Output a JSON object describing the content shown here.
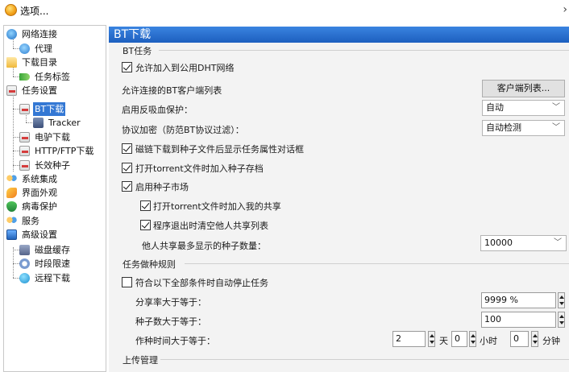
{
  "window": {
    "title": "选项...",
    "chevron": "›"
  },
  "tree": {
    "items": [
      {
        "label": "网络连接",
        "icon": "network-icon"
      },
      {
        "label": "代理",
        "icon": "proxy-icon"
      },
      {
        "label": "下载目录",
        "icon": "folder-icon"
      },
      {
        "label": "任务标签",
        "icon": "tag-icon"
      },
      {
        "label": "任务设置",
        "icon": "task-settings-icon"
      },
      {
        "label": "BT下载",
        "icon": "bt-icon"
      },
      {
        "label": "Tracker",
        "icon": "tracker-icon"
      },
      {
        "label": "电驴下载",
        "icon": "emule-icon"
      },
      {
        "label": "HTTP/FTP下载",
        "icon": "http-ftp-icon"
      },
      {
        "label": "长效种子",
        "icon": "seed-icon"
      },
      {
        "label": "系统集成",
        "icon": "system-integration-icon"
      },
      {
        "label": "界面外观",
        "icon": "appearance-icon"
      },
      {
        "label": "病毒保护",
        "icon": "virus-shield-icon"
      },
      {
        "label": "服务",
        "icon": "service-icon"
      },
      {
        "label": "高级设置",
        "icon": "advanced-icon"
      },
      {
        "label": "磁盘缓存",
        "icon": "disk-cache-icon"
      },
      {
        "label": "时段限速",
        "icon": "time-limit-icon"
      },
      {
        "label": "远程下载",
        "icon": "remote-download-icon"
      }
    ]
  },
  "panel": {
    "header": "BT下载",
    "group_bt_tasks": "BT任务",
    "allow_dht": "允许加入到公用DHT网络",
    "allowed_clients": "允许连接的BT客户端列表",
    "client_list_button": "客户端列表...",
    "anti_leech_label": "启用反吸血保护：",
    "anti_leech_value": "自动",
    "encryption_label": "协议加密（防范BT协议过滤）：",
    "encryption_value": "自动检测",
    "magnet_show_props": "磁链下载到种子文件后显示任务属性对话框",
    "open_torrent_add_archive": "打开torrent文件时加入种子存档",
    "enable_seed_market": "启用种子市场",
    "open_torrent_add_share": "打开torrent文件时加入我的共享",
    "clear_share_on_exit": "程序退出时清空他人共享列表",
    "max_seeds_label": "他人共享最多显示的种子数量：",
    "max_seeds_value": "10000",
    "group_rules": "任务做种规则",
    "auto_stop": "符合以下全部条件时自动停止任务",
    "ratio_label": "分享率大于等于：",
    "ratio_value": "9999 %",
    "seeds_label": "种子数大于等于：",
    "seeds_value": "100",
    "time_label": "作种时间大于等于：",
    "days_value": "2",
    "days_unit": "天",
    "hours_value": "0",
    "hours_unit": "小时",
    "minutes_value": "0",
    "minutes_unit": "分钟",
    "group_upload": "上传管理"
  }
}
